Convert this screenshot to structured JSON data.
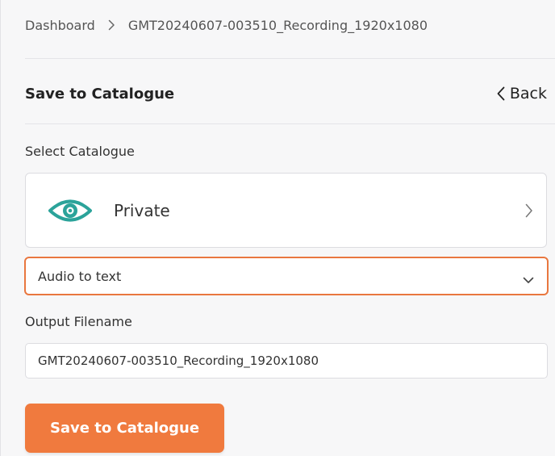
{
  "breadcrumb": {
    "root": "Dashboard",
    "current": "GMT20240607-003510_Recording_1920x1080"
  },
  "header": {
    "title": "Save to Catalogue",
    "back_label": "Back"
  },
  "catalogue": {
    "label": "Select Catalogue",
    "selected": "Private",
    "icon": "eye-icon",
    "icon_color": "#2ba39a"
  },
  "output_type": {
    "selected": "Audio to text",
    "border_color": "#e9773f"
  },
  "filename": {
    "label": "Output Filename",
    "value": "GMT20240607-003510_Recording_1920x1080"
  },
  "submit": {
    "label": "Save to Catalogue",
    "color": "#f07a3e"
  }
}
